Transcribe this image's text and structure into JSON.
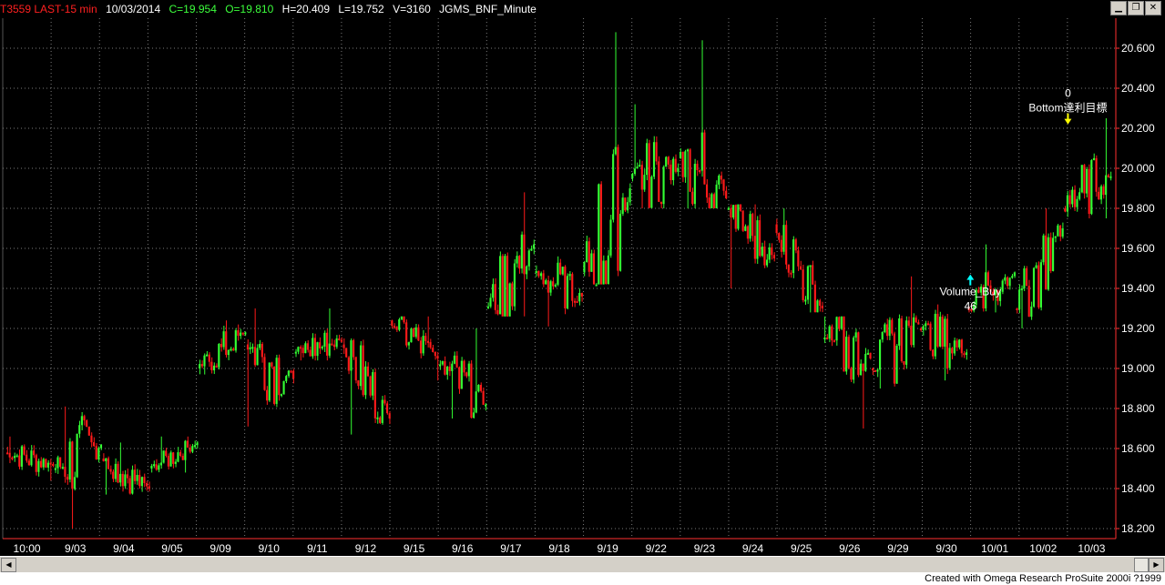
{
  "header": {
    "symbol": "T3559 LAST-15 min",
    "date": "10/03/2014",
    "close": "C=19.954",
    "open": "O=19.810",
    "high": "H=20.409",
    "low": "L=19.752",
    "volume": "V=3160",
    "strategy": "JGMS_BNF_Minute"
  },
  "window_buttons": [
    "▁",
    "❐",
    "✕"
  ],
  "footer": {
    "credit": "Created with Omega Research ProSuite 2000i ?1999"
  },
  "colors": {
    "up": "#33ff33",
    "down": "#ff1a1a",
    "grid": "#7a7a7a",
    "axis": "#ff3030",
    "background": "#000000",
    "signal": "#00ffff",
    "target": "#ffff00"
  },
  "chart_data": {
    "type": "bar",
    "style": "ohlc-blocks",
    "ylim": [
      18.15,
      20.75
    ],
    "yticks": [
      "20.600",
      "20.400",
      "20.200",
      "20.000",
      "19.800",
      "19.600",
      "19.400",
      "19.200",
      "19.000",
      "18.800",
      "18.600",
      "18.400",
      "18.200"
    ],
    "xticks": [
      "10:00",
      "9/03",
      "9/04",
      "9/05",
      "9/09",
      "9/10",
      "9/11",
      "9/12",
      "9/15",
      "9/16",
      "9/17",
      "9/18",
      "9/19",
      "9/22",
      "9/23",
      "9/24",
      "9/25",
      "9/26",
      "9/29",
      "9/30",
      "10/01",
      "10/02",
      "10/03"
    ],
    "grid": true,
    "axis_side": "right",
    "bars_per_session": 20,
    "sessions": [
      {
        "label": "9/03",
        "open": 18.58,
        "high": 18.66,
        "low": 18.44,
        "close": 18.52
      },
      {
        "label": "9/04",
        "open": 18.5,
        "high": 18.81,
        "low": 18.2,
        "close": 18.62
      },
      {
        "label": "9/05",
        "open": 18.55,
        "high": 18.63,
        "low": 18.37,
        "close": 18.4
      },
      {
        "label": "9/05b",
        "open": 18.5,
        "high": 18.66,
        "low": 18.48,
        "close": 18.63
      },
      {
        "label": "9/09",
        "open": 19.0,
        "high": 19.24,
        "low": 18.97,
        "close": 19.18
      },
      {
        "label": "9/10",
        "open": 19.12,
        "high": 19.3,
        "low": 18.71,
        "close": 18.95
      },
      {
        "label": "9/11",
        "open": 19.08,
        "high": 19.3,
        "low": 19.04,
        "close": 19.14
      },
      {
        "label": "9/12",
        "open": 19.12,
        "high": 19.15,
        "low": 18.67,
        "close": 18.75
      },
      {
        "label": "9/15",
        "open": 19.24,
        "high": 19.26,
        "low": 18.94,
        "close": 19.05
      },
      {
        "label": "9/16",
        "open": 19.02,
        "high": 19.2,
        "low": 18.75,
        "close": 18.82
      },
      {
        "label": "9/17",
        "open": 19.3,
        "high": 19.88,
        "low": 19.26,
        "close": 19.62
      },
      {
        "label": "9/18",
        "open": 19.48,
        "high": 19.56,
        "low": 19.21,
        "close": 19.36
      },
      {
        "label": "9/19",
        "open": 19.48,
        "high": 20.68,
        "low": 19.42,
        "close": 19.9
      },
      {
        "label": "9/22",
        "open": 19.95,
        "high": 20.32,
        "low": 19.8,
        "close": 20.0
      },
      {
        "label": "9/23",
        "open": 20.05,
        "high": 20.64,
        "low": 19.8,
        "close": 19.85
      },
      {
        "label": "9/24",
        "open": 19.8,
        "high": 19.82,
        "low": 19.4,
        "close": 19.55
      },
      {
        "label": "9/25",
        "open": 19.72,
        "high": 19.8,
        "low": 19.28,
        "close": 19.3
      },
      {
        "label": "9/26",
        "open": 19.15,
        "high": 19.26,
        "low": 18.7,
        "close": 19.05
      },
      {
        "label": "9/29",
        "open": 19.0,
        "high": 19.46,
        "low": 18.9,
        "close": 19.22
      },
      {
        "label": "9/30",
        "open": 19.2,
        "high": 19.32,
        "low": 18.94,
        "close": 19.08
      },
      {
        "label": "10/01",
        "open": 19.3,
        "high": 19.62,
        "low": 19.28,
        "close": 19.48
      },
      {
        "label": "10/02",
        "open": 19.3,
        "high": 19.8,
        "low": 19.2,
        "close": 19.7
      },
      {
        "label": "10/03",
        "open": 19.8,
        "high": 20.25,
        "low": 19.75,
        "close": 19.96
      }
    ],
    "annotations": [
      {
        "text": "Volume_Buy",
        "sub": "46",
        "x_session": 20,
        "x_frac": 0.05,
        "y": 19.47,
        "color": "#00ffff"
      },
      {
        "text": "Bottom達利目標",
        "sub": "0",
        "x_session": 22,
        "x_frac": 0.08,
        "y": 20.22,
        "color": "#ffff00"
      }
    ]
  }
}
